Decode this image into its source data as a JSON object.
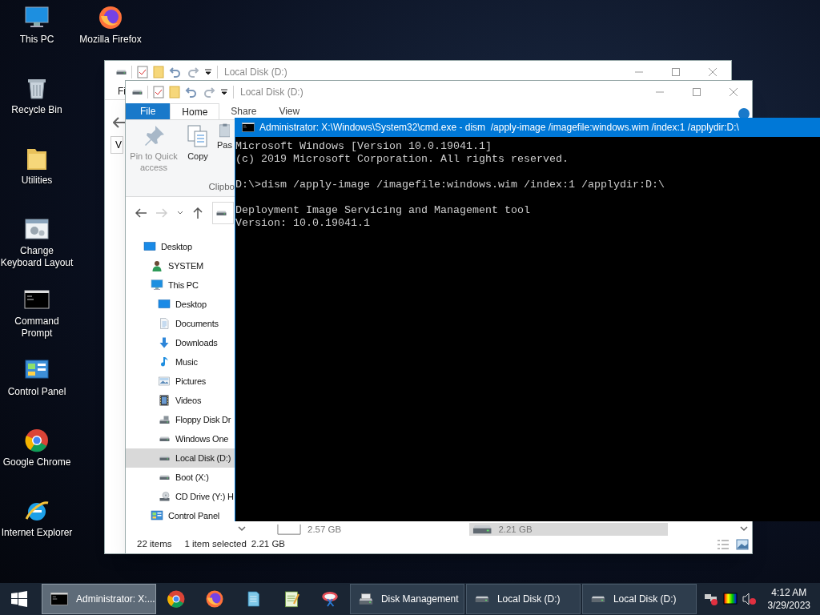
{
  "desktop": {
    "columns": [
      [
        {
          "label": "This PC",
          "kind": "pc"
        },
        {
          "label": "Recycle Bin",
          "kind": "recycle"
        },
        {
          "label": "Utilities",
          "kind": "folder"
        },
        {
          "label": "Change Keyboard Layout",
          "kind": "keyboard"
        },
        {
          "label": "Command Prompt",
          "kind": "cmd"
        },
        {
          "label": "Control Panel",
          "kind": "control"
        },
        {
          "label": "Google Chrome",
          "kind": "chrome"
        },
        {
          "label": "Internet Explorer",
          "kind": "ie"
        }
      ],
      [
        {
          "label": "Mozilla Firefox",
          "kind": "firefox"
        }
      ]
    ]
  },
  "back_window": {
    "title": "Local Disk (D:)",
    "tab": "Fi",
    "column_header": "V"
  },
  "explorer": {
    "title": "Local Disk (D:)",
    "tabs": [
      {
        "label": "File",
        "kind": "file",
        "selected": false
      },
      {
        "label": "Home",
        "kind": "tab",
        "selected": true
      },
      {
        "label": "Share",
        "kind": "tab",
        "selected": false
      },
      {
        "label": "View",
        "kind": "tab",
        "selected": false
      }
    ],
    "ribbon": [
      {
        "label": "Pin to Quick access",
        "kind": "pin",
        "disabled": true
      },
      {
        "label": "Copy",
        "kind": "copy",
        "disabled": false
      },
      {
        "label": "Pas",
        "kind": "paste",
        "disabled": false
      }
    ],
    "ribbon_group": "Clipbo",
    "nav_pane": [
      {
        "label": "Desktop",
        "kind": "desktop",
        "selected": false,
        "children": [
          {
            "label": "SYSTEM",
            "kind": "user",
            "selected": false
          },
          {
            "label": "This PC",
            "kind": "pc",
            "selected": false,
            "children": [
              {
                "label": "Desktop",
                "kind": "desktop",
                "selected": false
              },
              {
                "label": "Documents",
                "kind": "documents",
                "selected": false
              },
              {
                "label": "Downloads",
                "kind": "downloads",
                "selected": false
              },
              {
                "label": "Music",
                "kind": "music",
                "selected": false
              },
              {
                "label": "Pictures",
                "kind": "pictures",
                "selected": false
              },
              {
                "label": "Videos",
                "kind": "videos",
                "selected": false
              },
              {
                "label": "Floppy Disk Dr",
                "kind": "floppy",
                "selected": false
              },
              {
                "label": "Windows One",
                "kind": "drive",
                "selected": false
              },
              {
                "label": "Local Disk (D:)",
                "kind": "drive",
                "selected": true
              },
              {
                "label": "Boot (X:)",
                "kind": "drive",
                "selected": false
              },
              {
                "label": "CD Drive (Y:) H",
                "kind": "cd",
                "selected": false
              }
            ]
          },
          {
            "label": "Control Panel",
            "kind": "control",
            "selected": false
          }
        ]
      }
    ],
    "content_items": [
      {
        "size": "2.57 GB",
        "kind": "blank",
        "selected": false
      },
      {
        "size": "2.21 GB",
        "kind": "drive",
        "selected": true
      }
    ],
    "status": {
      "count": "22 items",
      "selection": "1 item selected",
      "size": "2.21 GB"
    }
  },
  "console": {
    "title": "Administrator: X:\\Windows\\System32\\cmd.exe - dism  /apply-image /imagefile:windows.wim /index:1 /applydir:D:\\",
    "blocks": [
      [
        "Microsoft Windows [Version 10.0.19041.1]",
        "(c) 2019 Microsoft Corporation. All rights reserved."
      ],
      [
        "D:\\>dism /apply-image /imagefile:windows.wim /index:1 /applydir:D:\\"
      ],
      [
        "Deployment Image Servicing and Management tool",
        "Version: 10.0.19041.1"
      ]
    ]
  },
  "taskbar": {
    "items": [
      {
        "kind": "cmd",
        "label": "Administrator: X:...",
        "active": true
      },
      {
        "kind": "chrome"
      },
      {
        "kind": "firefox"
      },
      {
        "kind": "notepad"
      },
      {
        "kind": "notepadpp"
      },
      {
        "kind": "snip"
      },
      {
        "kind": "diskmgmt",
        "label": "Disk Management",
        "active": false
      },
      {
        "kind": "drive",
        "label": "Local Disk (D:)",
        "active": false
      },
      {
        "kind": "drive",
        "label": "Local Disk (D:)",
        "active": false
      }
    ],
    "time": "4:12 AM",
    "date": "3/29/2023"
  }
}
